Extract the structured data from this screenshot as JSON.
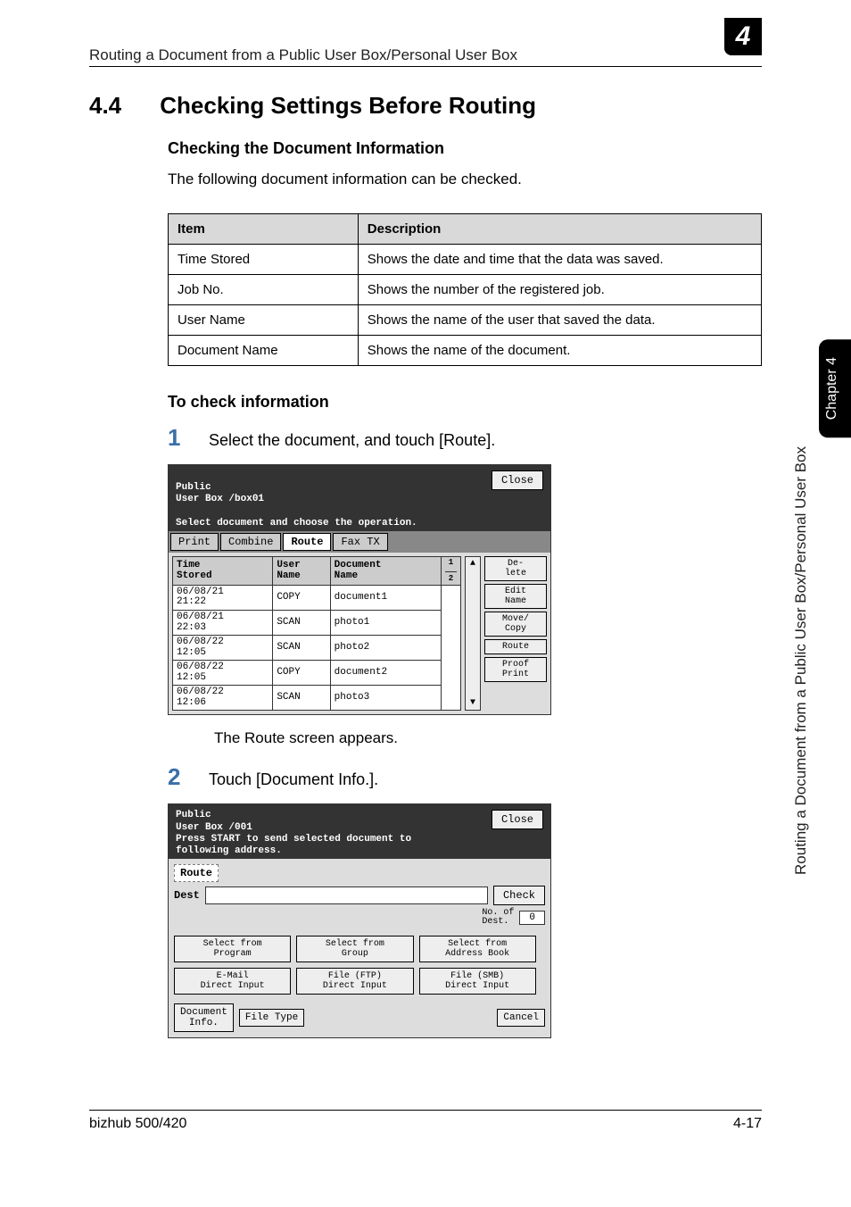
{
  "running_head": "Routing a Document from a Public User Box/Personal User Box",
  "chapter_number": "4",
  "section": {
    "number": "4.4",
    "title": "Checking Settings Before Routing"
  },
  "subhead1": "Checking the Document Information",
  "intro": "The following document information can be checked.",
  "table": {
    "headers": [
      "Item",
      "Description"
    ],
    "rows": [
      [
        "Time Stored",
        "Shows the date and time that the data was saved."
      ],
      [
        "Job No.",
        "Shows the number of the registered job."
      ],
      [
        "User Name",
        "Shows the name of the user that saved the data."
      ],
      [
        "Document Name",
        "Shows the name of the document."
      ]
    ]
  },
  "subhead2": "To check information",
  "steps": [
    {
      "num": "1",
      "text": "Select the document, and touch [Route]."
    },
    {
      "num": "2",
      "text": "Touch [Document Info.]."
    }
  ],
  "between_caption": "The Route screen appears.",
  "screenshot1": {
    "title_line1": "Public\nUser Box  /box01",
    "title_line2": "Select document and choose the operation.",
    "close": "Close",
    "tabs": [
      "Print",
      "Combine",
      "Route",
      "Fax TX"
    ],
    "active_tab": "Route",
    "columns": [
      "Time\nStored",
      "User\nName",
      "Document\nName"
    ],
    "page_indicator_top": "1",
    "page_indicator_bot": "2",
    "rows": [
      [
        "06/08/21\n21:22",
        "COPY",
        "document1"
      ],
      [
        "06/08/21\n22:03",
        "SCAN",
        "photo1"
      ],
      [
        "06/08/22\n12:05",
        "SCAN",
        "photo2"
      ],
      [
        "06/08/22\n12:05",
        "COPY",
        "document2"
      ],
      [
        "06/08/22\n12:06",
        "SCAN",
        "photo3"
      ]
    ],
    "side_buttons": [
      "De-\nlete",
      "Edit\nName",
      "Move/\nCopy",
      "Route",
      "Proof\nPrint"
    ],
    "scroll_up": "▲",
    "scroll_dn": "▼"
  },
  "screenshot2": {
    "title": "Public\nUser Box  /001\nPress START to send selected document to\nfollowing address.",
    "close": "Close",
    "section_label": "Route",
    "dest_label": "Dest",
    "check": "Check",
    "count_label": "No. of\nDest.",
    "count_value": "0",
    "buttons_row1": [
      "Select from\nProgram",
      "Select from\nGroup",
      "Select from\nAddress Book"
    ],
    "buttons_row2": [
      "E-Mail\nDirect Input",
      "File (FTP)\nDirect Input",
      "File (SMB)\nDirect Input"
    ],
    "bottom": {
      "doc_info": "Document\nInfo.",
      "file_type": "File Type",
      "cancel": "Cancel"
    }
  },
  "side_tab": "Chapter 4",
  "side_label": "Routing a Document from a Public User Box/Personal User Box",
  "footer": {
    "left": "bizhub 500/420",
    "right": "4-17"
  }
}
